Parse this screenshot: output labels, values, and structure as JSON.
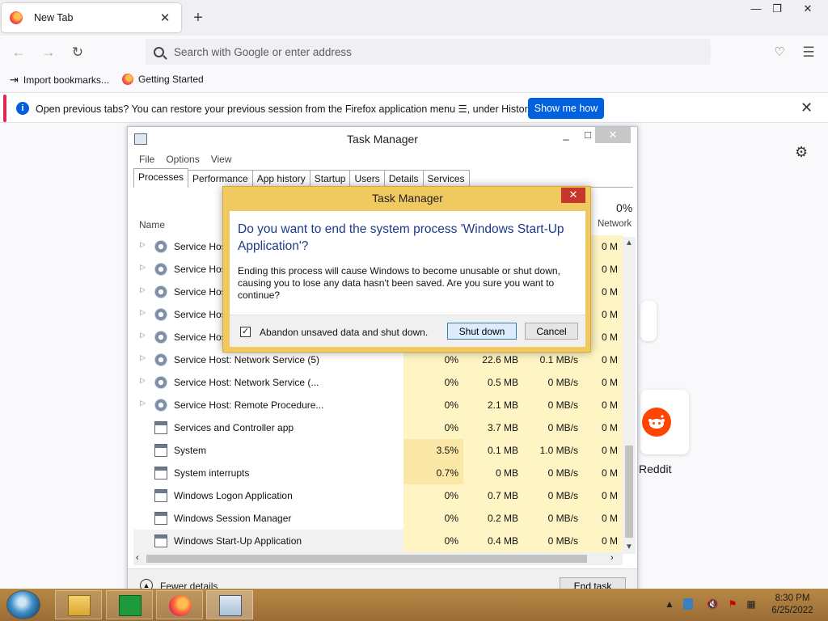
{
  "browser": {
    "tab_title": "New Tab",
    "url_placeholder": "Search with Google or enter address",
    "bookmarks": [
      "Import bookmarks...",
      "Getting Started"
    ],
    "notification": {
      "text": "Open previous tabs? You can restore your previous session from the Firefox application menu ☰, under History.",
      "button": "Show me how"
    },
    "shortcut_label": "Reddit"
  },
  "task_manager": {
    "title": "Task Manager",
    "menu": [
      "File",
      "Options",
      "View"
    ],
    "tabs": [
      "Processes",
      "Performance",
      "App history",
      "Startup",
      "Users",
      "Details",
      "Services"
    ],
    "column_name": "Name",
    "network_header_pct": "0%",
    "network_header": "Network",
    "rows": [
      {
        "name": "Service Hos",
        "cpu": "",
        "mem": "",
        "disk": "",
        "net": "0 M",
        "expand": true,
        "icon": "gear-icon"
      },
      {
        "name": "Service Hos",
        "cpu": "",
        "mem": "",
        "disk": "",
        "net": "0 M",
        "expand": true,
        "icon": "gear-icon"
      },
      {
        "name": "Service Hos",
        "cpu": "",
        "mem": "",
        "disk": "",
        "net": "0 M",
        "expand": true,
        "icon": "gear-icon"
      },
      {
        "name": "Service Hos",
        "cpu": "",
        "mem": "",
        "disk": "",
        "net": "0 M",
        "expand": true,
        "icon": "gear-icon"
      },
      {
        "name": "Service Hos",
        "cpu": "",
        "mem": "",
        "disk": "",
        "net": "0 M",
        "expand": true,
        "icon": "gear-icon"
      },
      {
        "name": "Service Host: Network Service (5)",
        "cpu": "0%",
        "mem": "22.6 MB",
        "disk": "0.1 MB/s",
        "net": "0 M",
        "expand": true,
        "icon": "gear-icon"
      },
      {
        "name": "Service Host: Network Service (...",
        "cpu": "0%",
        "mem": "0.5 MB",
        "disk": "0 MB/s",
        "net": "0 M",
        "expand": true,
        "icon": "gear-icon"
      },
      {
        "name": "Service Host: Remote Procedure...",
        "cpu": "0%",
        "mem": "2.1 MB",
        "disk": "0 MB/s",
        "net": "0 M",
        "expand": true,
        "icon": "gear-icon"
      },
      {
        "name": "Services and Controller app",
        "cpu": "0%",
        "mem": "3.7 MB",
        "disk": "0 MB/s",
        "net": "0 M",
        "expand": false,
        "icon": "app-icon"
      },
      {
        "name": "System",
        "cpu": "3.5%",
        "mem": "0.1 MB",
        "disk": "1.0 MB/s",
        "net": "0 M",
        "expand": false,
        "icon": "app-icon"
      },
      {
        "name": "System interrupts",
        "cpu": "0.7%",
        "mem": "0 MB",
        "disk": "0 MB/s",
        "net": "0 M",
        "expand": false,
        "icon": "app-icon"
      },
      {
        "name": "Windows Logon Application",
        "cpu": "0%",
        "mem": "0.7 MB",
        "disk": "0 MB/s",
        "net": "0 M",
        "expand": false,
        "icon": "app-icon"
      },
      {
        "name": "Windows Session Manager",
        "cpu": "0%",
        "mem": "0.2 MB",
        "disk": "0 MB/s",
        "net": "0 M",
        "expand": false,
        "icon": "app-icon"
      },
      {
        "name": "Windows Start-Up Application",
        "cpu": "0%",
        "mem": "0.4 MB",
        "disk": "0 MB/s",
        "net": "0 M",
        "expand": false,
        "icon": "app-icon"
      }
    ],
    "fewer_details": "Fewer details",
    "end_task": "End task"
  },
  "dialog": {
    "title": "Task Manager",
    "instruction": "Do you want to end the system process 'Windows Start-Up Application'?",
    "text": "Ending this process will cause Windows to become unusable or shut down, causing you to lose any data hasn't been saved. Are you sure you want to continue?",
    "checkbox_label": "Abandon unsaved data and shut down.",
    "checkbox_checked": true,
    "shutdown_button": "Shut down",
    "cancel_button": "Cancel"
  },
  "taskbar": {
    "time": "8:30 PM",
    "date": "6/25/2022"
  },
  "colors": {
    "firefox_blue": "#0061e0",
    "dialog_frame": "#f0c960",
    "taskbar": "#a6763c",
    "cpu_highlight": "#fff4c4"
  }
}
